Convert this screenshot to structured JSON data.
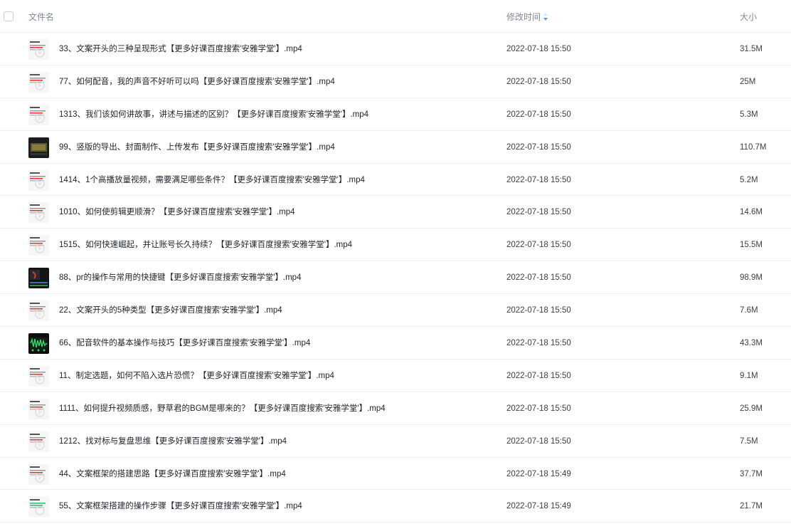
{
  "header": {
    "name_label": "文件名",
    "time_label": "修改时间",
    "size_label": "大小",
    "sort_icon": "sort-arrows-icon",
    "sort_color": "#4aa3ff"
  },
  "files": [
    {
      "name": "33、文案开头的三种呈现形式【更多好课百度搜索'安雅学堂'】.mp4",
      "modified": "2022-07-18 15:50",
      "size": "31.5M",
      "thumb": "doc-light"
    },
    {
      "name": "77、如何配音，我的声音不好听可以吗【更多好课百度搜索'安雅学堂'】.mp4",
      "modified": "2022-07-18 15:50",
      "size": "25M",
      "thumb": "doc-light"
    },
    {
      "name": "1313、我们该如何讲故事，讲述与描述的区别？【更多好课百度搜索'安雅学堂'】.mp4",
      "modified": "2022-07-18 15:50",
      "size": "5.3M",
      "thumb": "doc-light"
    },
    {
      "name": "99、竖版的导出、封面制作、上传发布【更多好课百度搜索'安雅学堂'】.mp4",
      "modified": "2022-07-18 15:50",
      "size": "110.7M",
      "thumb": "dark-video"
    },
    {
      "name": "1414、1个高播放量视频，需要满足哪些条件？【更多好课百度搜索'安雅学堂'】.mp4",
      "modified": "2022-07-18 15:50",
      "size": "5.2M",
      "thumb": "doc-light"
    },
    {
      "name": "1010、如何使剪辑更顺滑？【更多好课百度搜索'安雅学堂'】.mp4",
      "modified": "2022-07-18 15:50",
      "size": "14.6M",
      "thumb": "doc-light"
    },
    {
      "name": "1515、如何快速崛起，并让账号长久持续？【更多好课百度搜索'安雅学堂'】.mp4",
      "modified": "2022-07-18 15:50",
      "size": "15.5M",
      "thumb": "doc-light"
    },
    {
      "name": "88、pr的操作与常用的快捷键【更多好课百度搜索'安雅学堂'】.mp4",
      "modified": "2022-07-18 15:50",
      "size": "98.9M",
      "thumb": "dark-editor"
    },
    {
      "name": "22、文案开头的5种类型【更多好课百度搜索'安雅学堂'】.mp4",
      "modified": "2022-07-18 15:50",
      "size": "7.6M",
      "thumb": "doc-light"
    },
    {
      "name": "66、配音软件的基本操作与技巧【更多好课百度搜索'安雅学堂'】.mp4",
      "modified": "2022-07-18 15:50",
      "size": "43.3M",
      "thumb": "dark-audio"
    },
    {
      "name": "11、制定选题，如何不陷入选片恐慌？【更多好课百度搜索'安雅学堂'】.mp4",
      "modified": "2022-07-18 15:50",
      "size": "9.1M",
      "thumb": "doc-light"
    },
    {
      "name": "1111、如何提升视频质感，野草君的BGM是哪来的？【更多好课百度搜索'安雅学堂'】.mp4",
      "modified": "2022-07-18 15:50",
      "size": "25.9M",
      "thumb": "doc-light"
    },
    {
      "name": "1212、找对标与复盘思维【更多好课百度搜索'安雅学堂'】.mp4",
      "modified": "2022-07-18 15:50",
      "size": "7.5M",
      "thumb": "doc-light"
    },
    {
      "name": "44、文案框架的搭建思路【更多好课百度搜索'安雅学堂'】.mp4",
      "modified": "2022-07-18 15:49",
      "size": "37.7M",
      "thumb": "doc-light"
    },
    {
      "name": "55、文案框架搭建的操作步骤【更多好课百度搜索'安雅学堂'】.mp4",
      "modified": "2022-07-18 15:49",
      "size": "21.7M",
      "thumb": "doc-green"
    }
  ]
}
